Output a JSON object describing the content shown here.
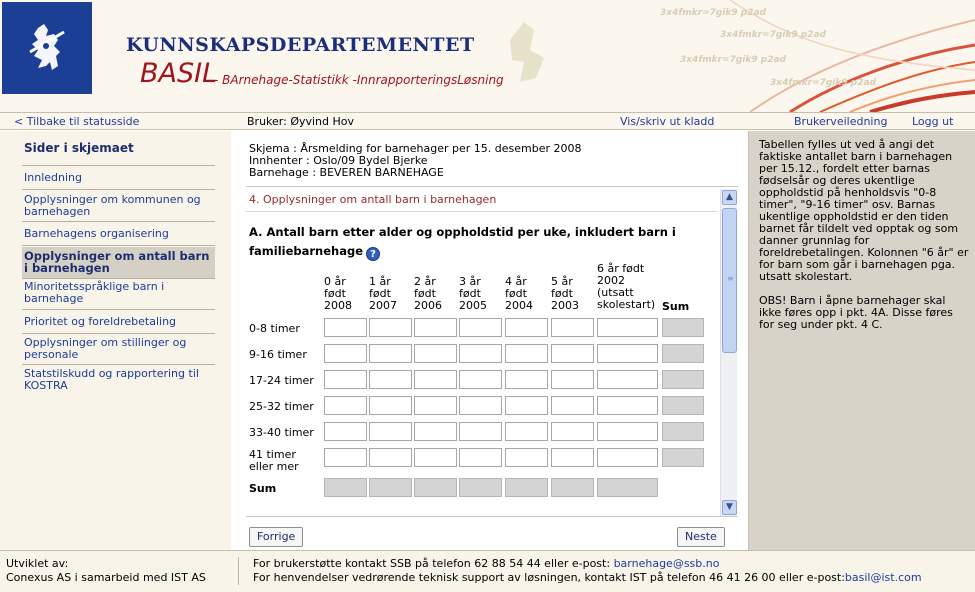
{
  "header": {
    "department": "KUNNSKAPSDEPARTEMENTET",
    "app_name": "BASIL",
    "app_subtitle": "- BArnehage-Statistikk -InnrapporteringsLøsning",
    "deco_text": "3x4fmkr=7gik9 p2ad"
  },
  "navbar": {
    "back_link": "< Tilbake til statusside",
    "user": "Bruker: Øyvind Hov",
    "draft_link": "Vis/skriv ut kladd",
    "guide_link": "Brukerveiledning",
    "logout_link": "Logg ut"
  },
  "sidebar": {
    "title": "Sider i skjemaet",
    "items": [
      {
        "label": "Innledning"
      },
      {
        "label": "Opplysninger om kommunen og barnehagen"
      },
      {
        "label": "Barnehagens organisering"
      },
      {
        "label": "Opplysninger om antall barn i barnehagen",
        "active": true
      },
      {
        "label": "Minoritetsspråklige barn i barnehage"
      },
      {
        "label": "Prioritet og foreldrebetaling"
      },
      {
        "label": "Opplysninger om stillinger og personale"
      },
      {
        "label": "Statstilskudd og rapportering til KOSTRA"
      }
    ]
  },
  "schema": {
    "line1": "Skjema : Årsmelding for barnehager per 15. desember 2008",
    "line2": "Innhenter : Oslo/09 Bydel Bjerke",
    "line3": "Barnehage : BEVEREN BARNEHAGE"
  },
  "form": {
    "section_title": "4. Opplysninger om antall barn i barnehagen",
    "subheading": "A. Antall barn etter alder og oppholdstid per uke, inkludert barn i familiebarnehage",
    "help_icon": "question-icon",
    "columns": [
      {
        "line1": "0 år",
        "line2": "født",
        "line3": "2008"
      },
      {
        "line1": "1 år",
        "line2": "født",
        "line3": "2007"
      },
      {
        "line1": "2 år",
        "line2": "født",
        "line3": "2006"
      },
      {
        "line1": "3 år",
        "line2": "født",
        "line3": "2005"
      },
      {
        "line1": "4 år",
        "line2": "født",
        "line3": "2004"
      },
      {
        "line1": "5 år",
        "line2": "født",
        "line3": "2003"
      },
      {
        "line1": "6 år født",
        "line2": "2002",
        "line3": "(utsatt",
        "line4": "skolestart)"
      }
    ],
    "sum_column": "Sum",
    "rows": [
      {
        "label": "0-8 timer"
      },
      {
        "label": "9-16 timer"
      },
      {
        "label": "17-24 timer"
      },
      {
        "label": "25-32 timer"
      },
      {
        "label": "33-40 timer"
      },
      {
        "label1": "41 timer",
        "label2": "eller mer"
      }
    ],
    "sum_row": "Sum",
    "prev_button": "Forrige",
    "next_button": "Neste"
  },
  "help": {
    "para1": "Tabellen fylles ut ved å angi det faktiske antallet barn i barnehagen per 15.12., fordelt etter barnas fødselsår og deres ukentlige oppholdstid på henholdsvis \"0-8 timer\", \"9-16 timer\" osv. Barnas ukentlige oppholdstid er den tiden barnet får tildelt ved opptak og som danner grunnlag for foreldrebetalingen. Kolonnen \"6 år\" er for barn som går i barnehagen pga. utsatt skolestart.",
    "para2": "OBS! Barn i åpne barnehager skal ikke føres opp i pkt. 4A. Disse føres for seg under pkt. 4 C."
  },
  "footer": {
    "dev_label": "Utviklet av:",
    "dev_name": "Conexus AS i samarbeid med IST AS",
    "support_text": "For brukerstøtte kontakt SSB på telefon 62 88 54 44 eller e-post:",
    "support_email": "barnehage@ssb.no",
    "tech_text": "For henvendelser vedrørende teknisk support av løsningen, kontakt IST på telefon 46 41 26 00 eller e-post:",
    "tech_email": "basil@ist.com"
  },
  "colors": {
    "brand_blue": "#1a3f95",
    "brand_red": "#a0141e",
    "link": "#1d3c99"
  }
}
